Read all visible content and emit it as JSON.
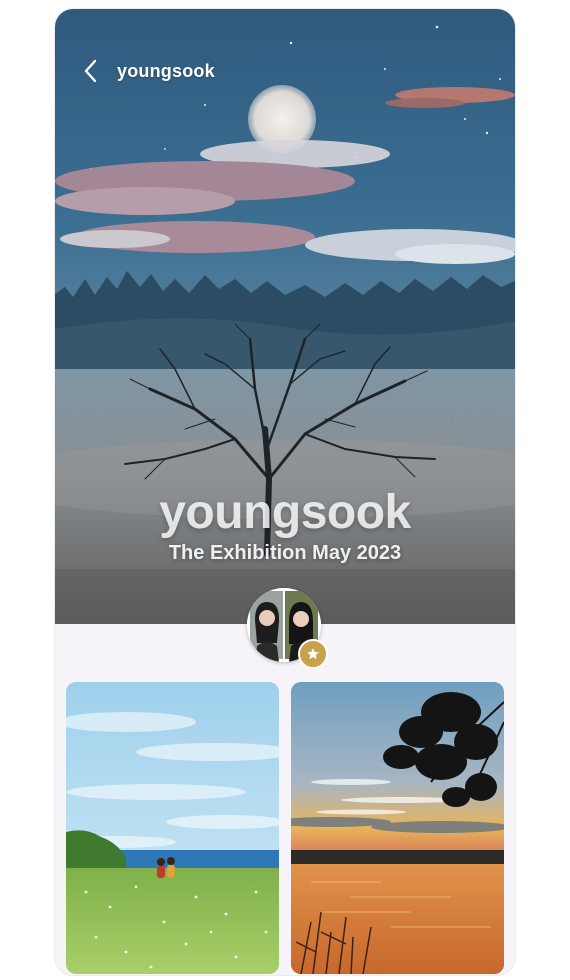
{
  "header": {
    "username": "youngsook",
    "back_icon": "chevron-left-icon"
  },
  "hero": {
    "title": "youngsook",
    "subtitle": "The Exhibition May 2023"
  },
  "profile": {
    "badge_icon": "star-icon",
    "badge_color": "#c9a24b"
  },
  "gallery": {
    "items": [
      {
        "scene": "meadow-couple-seascape"
      },
      {
        "scene": "sunset-lake-tree-silhouette"
      }
    ]
  }
}
